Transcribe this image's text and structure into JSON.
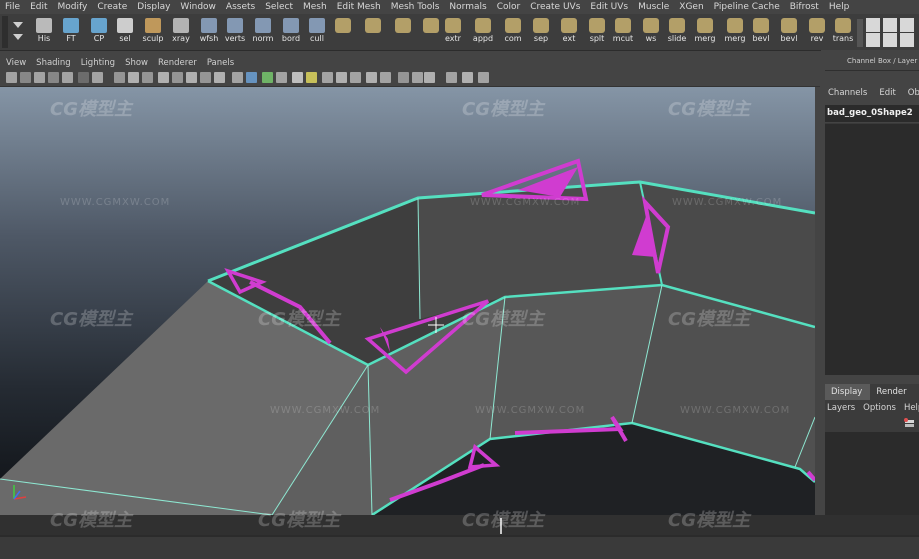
{
  "menu": [
    "File",
    "Edit",
    "Modify",
    "Create",
    "Display",
    "Window",
    "Assets",
    "Select",
    "Mesh",
    "Edit Mesh",
    "Mesh Tools",
    "Normals",
    "Color",
    "Create UVs",
    "Edit UVs",
    "Muscle",
    "XGen",
    "Pipeline Cache",
    "Bifrost",
    "Help"
  ],
  "shelf": {
    "tools": [
      "His",
      "FT",
      "CP",
      "sel",
      "sculp",
      "xray",
      "wfsh",
      "verts",
      "norm",
      "bord",
      "cull",
      "",
      "",
      "",
      "",
      "extr",
      "appd",
      "com",
      "sep",
      "ext",
      "splt",
      "mcut",
      "ws",
      "slide",
      "merg",
      "merg",
      "bevl",
      "bevl",
      "rev",
      "trans"
    ]
  },
  "viewport_menu": [
    "View",
    "Shading",
    "Lighting",
    "Show",
    "Renderer",
    "Panels"
  ],
  "right_panel": {
    "title": "Channel Box / Layer E",
    "tabs": [
      "Channels",
      "Edit",
      "Obje"
    ],
    "object_name": "bad_geo_0Shape2",
    "lower_tabs": [
      "Display",
      "Render"
    ],
    "lower_menu": [
      "Layers",
      "Options",
      "Help"
    ]
  },
  "watermark": {
    "logo": "CG模型主",
    "url": "WWW.CGMXW.COM"
  },
  "colors": {
    "edge_highlight": "#55e0c0",
    "problem_face": "#d03cd0",
    "background_top": "#7f8ea0",
    "background_bottom": "#0e1116",
    "mesh_gray": "#6a6a6a"
  }
}
